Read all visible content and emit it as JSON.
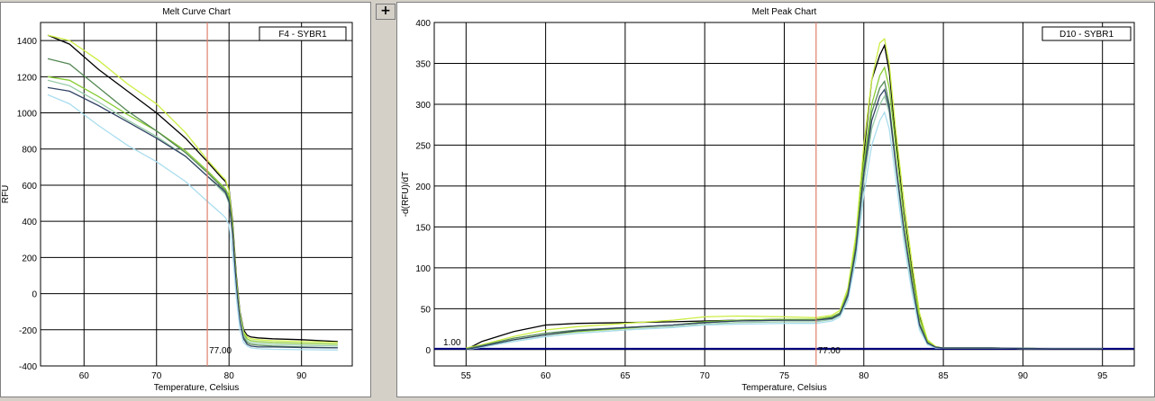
{
  "toolbar": {
    "expand_label": "+"
  },
  "chart_data": [
    {
      "type": "line",
      "title": "Melt Curve Chart",
      "legend_label": "F4 - SYBR1",
      "legend_placement": "top-right",
      "xlabel": "Temperature, Celsius",
      "ylabel": "RFU",
      "xlim": [
        54,
        97
      ],
      "ylim": [
        -400,
        1500
      ],
      "xticks": [
        60,
        70,
        80,
        90
      ],
      "yticks": [
        -400,
        -200,
        0,
        200,
        400,
        600,
        800,
        1000,
        1200,
        1400
      ],
      "grid": true,
      "marker_line": {
        "x": 77,
        "label": "77.00",
        "color": "#e0806a"
      },
      "series": [
        {
          "color": "#000000",
          "x": [
            55,
            58,
            62,
            66,
            70,
            74,
            77,
            79,
            79.5,
            80,
            80.5,
            81,
            81.5,
            82,
            82.5,
            83,
            84,
            86,
            90,
            95
          ],
          "y": [
            1430,
            1380,
            1240,
            1120,
            1000,
            860,
            730,
            640,
            620,
            580,
            400,
            100,
            -100,
            -200,
            -230,
            -240,
            -245,
            -250,
            -255,
            -265
          ]
        },
        {
          "color": "#ccee44",
          "x": [
            55,
            58,
            62,
            66,
            70,
            74,
            77,
            79,
            79.5,
            80,
            80.5,
            81,
            81.5,
            82,
            82.5,
            83,
            84,
            86,
            90,
            95
          ],
          "y": [
            1430,
            1400,
            1290,
            1160,
            1050,
            890,
            740,
            650,
            630,
            570,
            380,
            80,
            -110,
            -210,
            -240,
            -250,
            -255,
            -260,
            -265,
            -270
          ]
        },
        {
          "color": "#88cc33",
          "x": [
            55,
            58,
            62,
            66,
            70,
            74,
            77,
            79,
            79.5,
            80,
            80.5,
            81,
            81.5,
            82,
            82.5,
            83,
            84,
            86,
            90,
            95
          ],
          "y": [
            1200,
            1180,
            1090,
            990,
            900,
            790,
            680,
            600,
            580,
            540,
            360,
            60,
            -120,
            -220,
            -250,
            -260,
            -265,
            -270,
            -275,
            -280
          ]
        },
        {
          "color": "#558855",
          "x": [
            55,
            58,
            62,
            66,
            70,
            74,
            77,
            79,
            79.5,
            80,
            80.5,
            81,
            81.5,
            82,
            82.5,
            83,
            84,
            86,
            90,
            95
          ],
          "y": [
            1300,
            1270,
            1140,
            1010,
            900,
            780,
            670,
            590,
            570,
            520,
            340,
            50,
            -140,
            -240,
            -270,
            -280,
            -285,
            -290,
            -295,
            -300
          ]
        },
        {
          "color": "#99ccaa",
          "x": [
            55,
            58,
            62,
            66,
            70,
            74,
            77,
            79,
            79.5,
            80,
            80.5,
            81,
            81.5,
            82,
            82.5,
            83,
            84,
            86,
            90,
            95
          ],
          "y": [
            1180,
            1150,
            1060,
            960,
            870,
            760,
            650,
            570,
            550,
            500,
            320,
            40,
            -130,
            -230,
            -260,
            -270,
            -275,
            -280,
            -285,
            -290
          ]
        },
        {
          "color": "#334466",
          "x": [
            55,
            58,
            62,
            66,
            70,
            74,
            77,
            79,
            79.5,
            80,
            80.5,
            81,
            81.5,
            82,
            82.5,
            83,
            84,
            86,
            90,
            95
          ],
          "y": [
            1140,
            1120,
            1040,
            950,
            860,
            760,
            650,
            580,
            560,
            510,
            330,
            40,
            -150,
            -250,
            -280,
            -290,
            -295,
            -295,
            -298,
            -300
          ]
        },
        {
          "color": "#aaddee",
          "x": [
            55,
            58,
            62,
            66,
            70,
            74,
            77,
            79,
            79.5,
            80,
            80.5,
            81,
            81.5,
            82,
            82.5,
            83,
            84,
            86,
            90,
            95
          ],
          "y": [
            1100,
            1050,
            930,
            820,
            730,
            620,
            510,
            440,
            420,
            380,
            220,
            -20,
            -200,
            -270,
            -290,
            -300,
            -305,
            -308,
            -310,
            -312
          ]
        }
      ]
    },
    {
      "type": "line",
      "title": "Melt Peak Chart",
      "legend_label": "D10 - SYBR1",
      "legend_placement": "top-right",
      "xlabel": "Temperature, Celsius",
      "ylabel": "-d(RFU)/dT",
      "xlim": [
        53,
        97
      ],
      "ylim": [
        -20,
        400
      ],
      "xticks": [
        55,
        60,
        65,
        70,
        75,
        80,
        85,
        90,
        95
      ],
      "yticks": [
        0,
        50,
        100,
        150,
        200,
        250,
        300,
        350,
        400
      ],
      "grid": true,
      "marker_line": {
        "x": 77,
        "label": "77.00",
        "color": "#e0806a"
      },
      "threshold_line": {
        "y": 1,
        "label": "1.00",
        "color": "#000080"
      },
      "series": [
        {
          "color": "#000000",
          "x": [
            55,
            56,
            58,
            60,
            62,
            65,
            68,
            70,
            72,
            75,
            77,
            78,
            78.5,
            79,
            79.5,
            80,
            80.5,
            81,
            81.3,
            81.6,
            82,
            82.5,
            83,
            83.5,
            84,
            84.5,
            85,
            88,
            92,
            95
          ],
          "y": [
            0,
            10,
            22,
            30,
            32,
            33,
            34,
            35,
            36,
            37,
            37,
            40,
            45,
            70,
            130,
            240,
            330,
            360,
            372,
            340,
            260,
            170,
            100,
            40,
            10,
            3,
            2,
            2,
            1,
            1
          ]
        },
        {
          "color": "#ccee44",
          "x": [
            55,
            56,
            58,
            60,
            62,
            65,
            68,
            70,
            72,
            75,
            77,
            78,
            78.5,
            79,
            79.5,
            80,
            80.5,
            81,
            81.3,
            81.6,
            82,
            82.5,
            83,
            83.5,
            84,
            84.5,
            85,
            88,
            92,
            95
          ],
          "y": [
            2,
            6,
            16,
            24,
            28,
            32,
            36,
            40,
            41,
            40,
            39,
            42,
            48,
            75,
            140,
            250,
            330,
            375,
            380,
            350,
            270,
            185,
            110,
            45,
            12,
            4,
            2,
            2,
            1,
            1
          ]
        },
        {
          "color": "#88cc33",
          "x": [
            55,
            56,
            58,
            60,
            62,
            65,
            68,
            70,
            72,
            75,
            77,
            78,
            78.5,
            79,
            79.5,
            80,
            80.5,
            81,
            81.3,
            81.6,
            82,
            82.5,
            83,
            83.5,
            84,
            84.5,
            85,
            88,
            92,
            95
          ],
          "y": [
            0,
            4,
            12,
            18,
            22,
            26,
            30,
            34,
            36,
            37,
            37,
            40,
            45,
            70,
            130,
            230,
            300,
            335,
            345,
            320,
            250,
            165,
            95,
            38,
            10,
            3,
            2,
            2,
            1,
            1
          ]
        },
        {
          "color": "#558855",
          "x": [
            55,
            56,
            58,
            60,
            62,
            65,
            68,
            70,
            72,
            75,
            77,
            78,
            78.5,
            79,
            79.5,
            80,
            80.5,
            81,
            81.3,
            81.6,
            82,
            82.5,
            83,
            83.5,
            84,
            84.5,
            85,
            88,
            92,
            95
          ],
          "y": [
            1,
            5,
            14,
            20,
            24,
            27,
            30,
            33,
            35,
            36,
            36,
            39,
            44,
            68,
            125,
            220,
            290,
            320,
            328,
            300,
            230,
            150,
            85,
            32,
            8,
            3,
            2,
            2,
            1,
            1
          ]
        },
        {
          "color": "#99ccaa",
          "x": [
            55,
            56,
            58,
            60,
            62,
            65,
            68,
            70,
            72,
            75,
            77,
            78,
            78.5,
            79,
            79.5,
            80,
            80.5,
            81,
            81.3,
            81.6,
            82,
            82.5,
            83,
            83.5,
            84,
            84.5,
            85,
            88,
            92,
            95
          ],
          "y": [
            0,
            3,
            10,
            16,
            20,
            24,
            28,
            31,
            33,
            34,
            34,
            37,
            42,
            64,
            118,
            205,
            270,
            300,
            310,
            290,
            225,
            145,
            80,
            28,
            7,
            2,
            2,
            2,
            1,
            1
          ]
        },
        {
          "color": "#aaddee",
          "x": [
            55,
            56,
            58,
            60,
            62,
            65,
            68,
            70,
            72,
            75,
            77,
            78,
            78.5,
            79,
            79.5,
            80,
            80.5,
            81,
            81.3,
            81.6,
            82,
            82.5,
            83,
            83.5,
            84,
            84.5,
            85,
            88,
            92,
            95
          ],
          "y": [
            0,
            3,
            10,
            16,
            20,
            24,
            27,
            30,
            31,
            32,
            32,
            35,
            40,
            60,
            110,
            190,
            250,
            280,
            290,
            270,
            210,
            135,
            72,
            24,
            6,
            2,
            2,
            2,
            1,
            1
          ]
        },
        {
          "color": "#334466",
          "x": [
            55,
            56,
            58,
            60,
            62,
            65,
            68,
            70,
            72,
            75,
            77,
            78,
            78.5,
            79,
            79.5,
            80,
            80.5,
            81,
            81.3,
            81.6,
            82,
            82.5,
            83,
            83.5,
            84,
            84.5,
            85,
            88,
            92,
            95
          ],
          "y": [
            0,
            4,
            12,
            18,
            23,
            27,
            30,
            33,
            35,
            36,
            36,
            38,
            43,
            66,
            122,
            215,
            280,
            310,
            318,
            295,
            228,
            150,
            85,
            30,
            8,
            3,
            2,
            2,
            1,
            1
          ]
        }
      ]
    }
  ]
}
